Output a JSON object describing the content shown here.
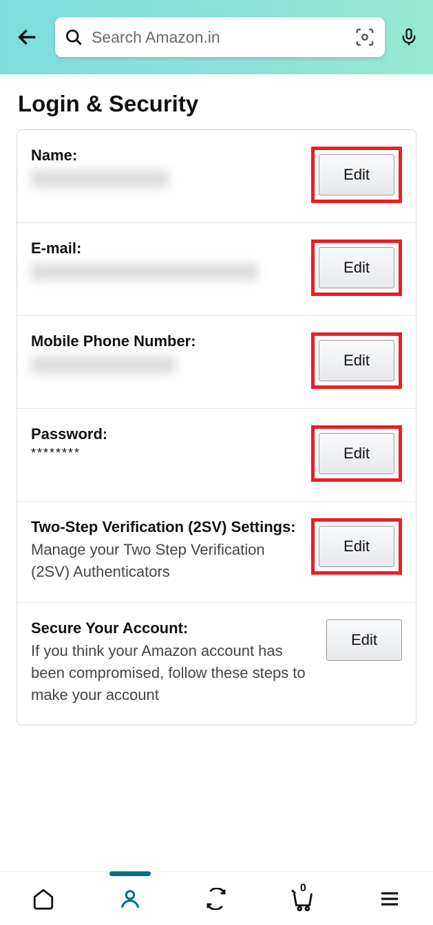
{
  "header": {
    "search_placeholder": "Search Amazon.in"
  },
  "page": {
    "title": "Login & Security"
  },
  "settings": {
    "name": {
      "label": "Name:",
      "edit": "Edit"
    },
    "email": {
      "label": "E-mail:",
      "edit": "Edit"
    },
    "phone": {
      "label": "Mobile Phone Number:",
      "edit": "Edit"
    },
    "password": {
      "label": "Password:",
      "mask": "********",
      "edit": "Edit"
    },
    "two_step": {
      "label": "Two-Step Verification (2SV) Settings:",
      "desc": "Manage your Two Step Verification (2SV) Authenticators",
      "edit": "Edit"
    },
    "secure": {
      "label": "Secure Your Account:",
      "desc": "If you think your Amazon account has been compromised, follow these steps to make your account",
      "edit": "Edit"
    }
  },
  "nav": {
    "cart_count": "0"
  }
}
